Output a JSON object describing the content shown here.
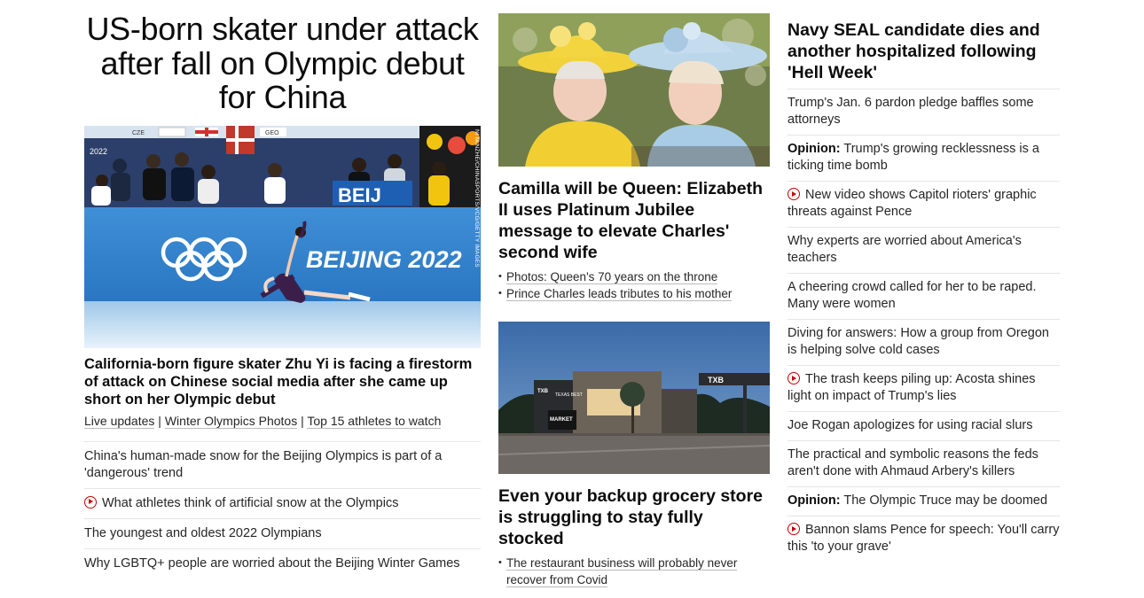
{
  "left": {
    "headline": "US-born skater under attack after fall on Olympic debut for China",
    "photo_credit": "NI MINZHE/CHINASPORTS/VCG/GETTY IMAGES",
    "photo_text": {
      "banner": "BEIJING 2022",
      "board": "BEIJ",
      "board_sign_left": "CZE",
      "board_sign_right": "GEO",
      "corner": "2022"
    },
    "caption": "California-born figure skater Zhu Yi is facing a firestorm of attack on Chinese social media after she came up short on her Olympic debut",
    "links": [
      "Live updates",
      "Winter Olympics Photos",
      "Top 15 athletes to watch"
    ],
    "link_separator": "|",
    "stories": [
      {
        "text": "China's human-made snow for the Beijing Olympics is part of a 'dangerous' trend",
        "video": false
      },
      {
        "text": "What athletes think of artificial snow at the Olympics",
        "video": true
      },
      {
        "text": "The youngest and oldest 2022 Olympians",
        "video": false
      },
      {
        "text": "Why LGBTQ+ people are worried about the Beijing Winter Games",
        "video": false
      }
    ]
  },
  "middle": {
    "card1": {
      "title": "Camilla will be Queen: Elizabeth II uses Platinum Jubilee message to elevate Charles' second wife",
      "links": [
        "Photos: Queen's 70 years on the throne",
        "Prince Charles leads tributes to his mother"
      ]
    },
    "card2": {
      "title": "Even your backup grocery store is struggling to stay fully stocked",
      "links": [
        "The restaurant business will probably never recover from Covid"
      ],
      "photo_text": {
        "sign_left": "TXB",
        "sign_mid": "MARKET",
        "sign_right": "TXB",
        "sign_center": "TEXAS BEST"
      }
    }
  },
  "right": {
    "headline": "Navy SEAL candidate dies and another hospitalized following 'Hell Week'",
    "stories": [
      {
        "prefix": "",
        "text": "Trump's Jan. 6 pardon pledge baffles some attorneys",
        "video": false
      },
      {
        "prefix": "Opinion:",
        "text": "Trump's growing recklessness is a ticking time bomb",
        "video": false
      },
      {
        "prefix": "",
        "text": "New video shows Capitol rioters' graphic threats against Pence",
        "video": true
      },
      {
        "prefix": "",
        "text": "Why experts are worried about America's teachers",
        "video": false
      },
      {
        "prefix": "",
        "text": "A cheering crowd called for her to be raped. Many were women",
        "video": false
      },
      {
        "prefix": "",
        "text": "Diving for answers: How a group from Oregon is helping solve cold cases",
        "video": false
      },
      {
        "prefix": "",
        "text": "The trash keeps piling up: Acosta shines light on impact of Trump's lies",
        "video": true
      },
      {
        "prefix": "",
        "text": "Joe Rogan apologizes for using racial slurs",
        "video": false
      },
      {
        "prefix": "",
        "text": "The practical and symbolic reasons the feds aren't done with Ahmaud Arbery's killers",
        "video": false
      },
      {
        "prefix": "Opinion:",
        "text": "The Olympic Truce may be doomed",
        "video": false
      },
      {
        "prefix": "",
        "text": "Bannon slams Pence for speech: You'll carry this 'to your grave'",
        "video": true
      }
    ]
  },
  "colors": {
    "text": "#0c0c0c",
    "secondary_text": "#262626",
    "video_icon": "#cc0000",
    "divider": "#e6e6e6"
  }
}
